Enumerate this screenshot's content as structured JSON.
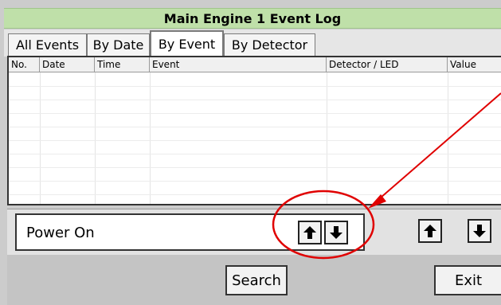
{
  "window": {
    "title": "Main Engine 1 Event Log"
  },
  "tabs": [
    {
      "label": "All Events",
      "active": false
    },
    {
      "label": "By Date",
      "active": false
    },
    {
      "label": "By Event",
      "active": true
    },
    {
      "label": "By Detector",
      "active": false
    }
  ],
  "table": {
    "columns": [
      "No.",
      "Date",
      "Time",
      "Event",
      "Detector / LED",
      "Value"
    ],
    "rows": []
  },
  "search": {
    "value": "Power On"
  },
  "buttons": {
    "search": "Search",
    "exit": "Exit"
  },
  "icons": {
    "up": "arrow-up-icon",
    "down": "arrow-down-icon"
  },
  "colors": {
    "title_bar": "#bfe0a9",
    "annotation": "#e00000"
  }
}
